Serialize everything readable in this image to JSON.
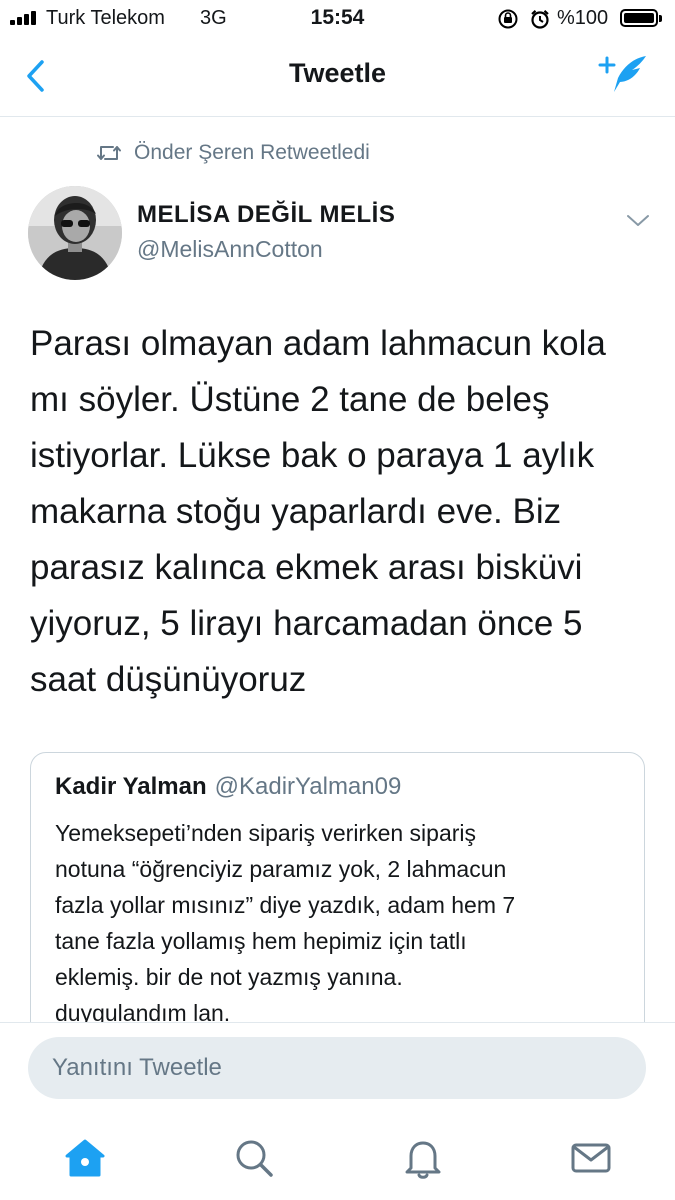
{
  "status_bar": {
    "carrier": "Turk Telekom",
    "network": "3G",
    "time": "15:54",
    "battery": "%100",
    "icons": [
      "orientation-lock-icon",
      "alarm-icon"
    ]
  },
  "nav": {
    "title": "Tweetle",
    "back_icon": "chevron-left-icon",
    "compose_icon": "compose-tweet-icon"
  },
  "retweet": {
    "icon": "retweet-icon",
    "text": "Önder Şeren Retweetledi"
  },
  "tweet": {
    "author_name": "MELİSA DEĞİL MELİS",
    "author_handle": "@MelisAnnCotton",
    "text": "Parası olmayan adam lahmacun kola\nmı söyler. Üstüne 2 tane de beleş\nistiyorlar. Lükse bak o paraya 1 aylık\nmakarna stoğu yaparlardı eve. Biz\nparasız kalınca ekmek arası bisküvi\nyiyoruz, 5 lirayı harcamadan önce 5\nsaat düşünüyoruz"
  },
  "quoted_tweet": {
    "name": "Kadir Yalman",
    "handle": "@KadirYalman09",
    "text": "Yemeksepeti’nden sipariş verirken sipariş\nnotuna “öğrenciyiz paramız yok, 2 lahmacun\nfazla yollar mısınız” diye yazdık, adam hem 7\ntane fazla yollamış hem hepimiz için tatlı\neklemiş. bir de not yazmış yanına.\nduygulandım lan."
  },
  "reply": {
    "placeholder": "Yanıtını Tweetle"
  },
  "tab_bar": {
    "items": [
      "home-icon",
      "search-icon",
      "notifications-icon",
      "messages-icon"
    ],
    "active": "home-icon"
  },
  "colors": {
    "accent": "#1da1f2",
    "secondary_text": "#657786",
    "input_bg": "#e6ecf0",
    "border": "#e1e8ed"
  }
}
